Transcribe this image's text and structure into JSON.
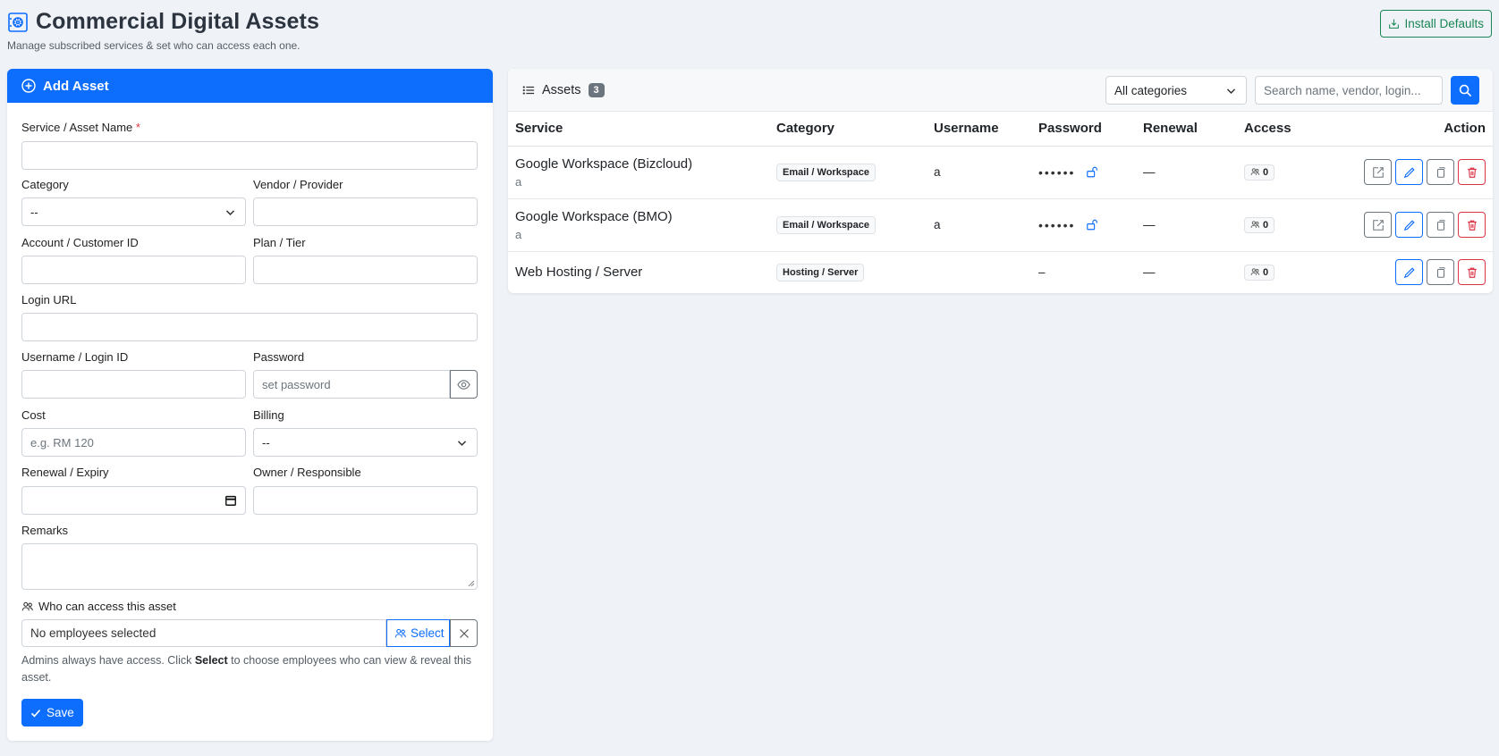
{
  "header": {
    "title": "Commercial Digital Assets",
    "subtitle": "Manage subscribed services & set who can access each one.",
    "install_defaults_label": "Install Defaults"
  },
  "form": {
    "title": "Add Asset",
    "service_name_label": "Service / Asset Name",
    "required_mark": "*",
    "category_label": "Category",
    "category_value": "--",
    "vendor_label": "Vendor / Provider",
    "account_label": "Account / Customer ID",
    "plan_label": "Plan / Tier",
    "login_url_label": "Login URL",
    "username_label": "Username / Login ID",
    "password_label": "Password",
    "password_placeholder": "set password",
    "cost_label": "Cost",
    "cost_placeholder": "e.g. RM 120",
    "billing_label": "Billing",
    "billing_value": "--",
    "renewal_label": "Renewal / Expiry",
    "owner_label": "Owner / Responsible",
    "remarks_label": "Remarks",
    "access_label": "Who can access this asset",
    "employees_value": "No employees selected",
    "select_label": "Select",
    "help_pre": "Admins always have access. Click ",
    "help_bold": "Select",
    "help_post": " to choose employees who can view & reveal this asset.",
    "save_label": "Save"
  },
  "assets": {
    "title": "Assets",
    "count": "3",
    "category_filter": "All categories",
    "search_placeholder": "Search name, vendor, login...",
    "columns": [
      "Service",
      "Category",
      "Username",
      "Password",
      "Renewal",
      "Access",
      "Action"
    ],
    "rows": [
      {
        "service": "Google Workspace (Bizcloud)",
        "sub": "a",
        "category": "Email / Workspace",
        "username": "a",
        "password": "••••••",
        "renewal": "—",
        "access": "0"
      },
      {
        "service": "Google Workspace (BMO)",
        "sub": "a",
        "category": "Email / Workspace",
        "username": "a",
        "password": "••••••",
        "renewal": "—",
        "access": "0"
      },
      {
        "service": "Web Hosting / Server",
        "sub": "",
        "category": "Hosting / Server",
        "username": "",
        "password": "–",
        "renewal": "—",
        "access": "0"
      }
    ]
  }
}
